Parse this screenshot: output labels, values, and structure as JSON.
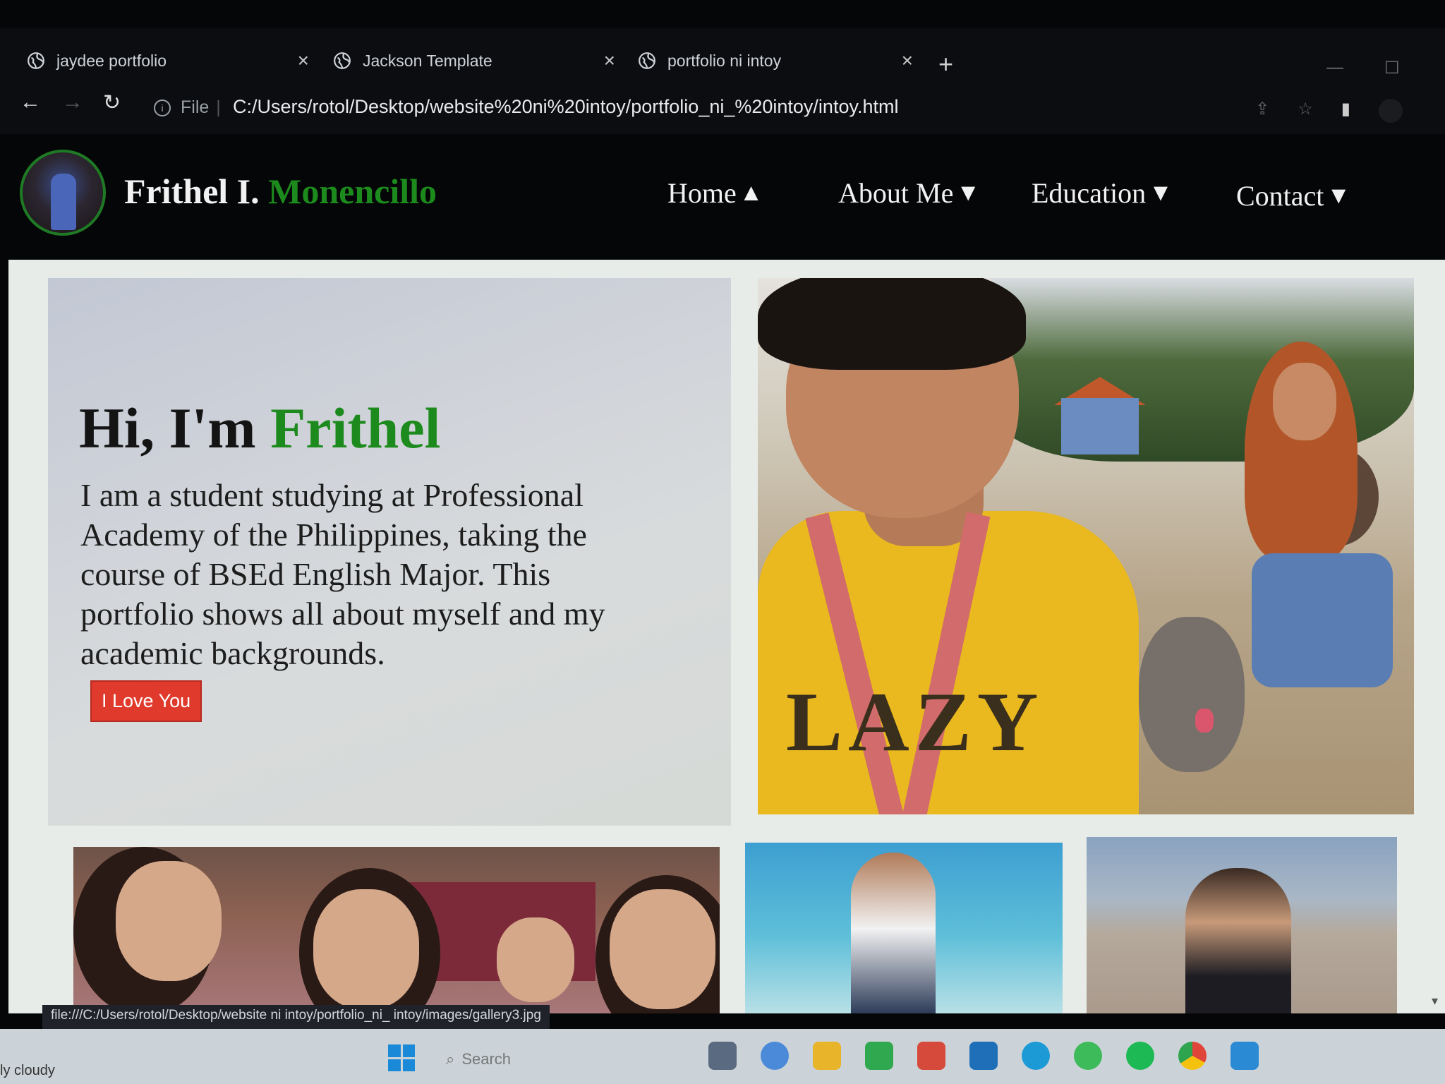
{
  "browser": {
    "tabs": [
      {
        "title": "jaydee portfolio",
        "close": "×"
      },
      {
        "title": "Jackson Template",
        "close": "×"
      },
      {
        "title": "portfolio ni intoy",
        "close": "×"
      }
    ],
    "new_tab": "+",
    "file_label": "File",
    "url": "C:/Users/rotol/Desktop/website%20ni%20intoy/portfolio_ni_%20intoy/intoy.html",
    "status_url": "file:///C:/Users/rotol/Desktop/website ni intoy/portfolio_ni_ intoy/images/gallery3.jpg"
  },
  "site": {
    "brand_first": "Frithel I.",
    "brand_last": "Monencillo",
    "nav": [
      {
        "label": "Home",
        "arrow": "▲"
      },
      {
        "label": "About Me",
        "arrow": "▼"
      },
      {
        "label": "Education",
        "arrow": "▼"
      },
      {
        "label": "Contact",
        "arrow": "▼"
      }
    ],
    "hero": {
      "greeting": "Hi, I'm",
      "name": "Frithel",
      "text": "I am a student studying at Professional Academy of the Philippines, taking the course of BSEd English Major. This portfolio shows all about myself and my academic backgrounds.",
      "button": "I Love You"
    },
    "photo_text": "LAZY"
  },
  "taskbar": {
    "weather": "ly cloudy",
    "search": "Search"
  },
  "colors": {
    "accent_green": "#1d8a1d",
    "button_red": "#e03a2c",
    "header_bg": "#050607"
  }
}
